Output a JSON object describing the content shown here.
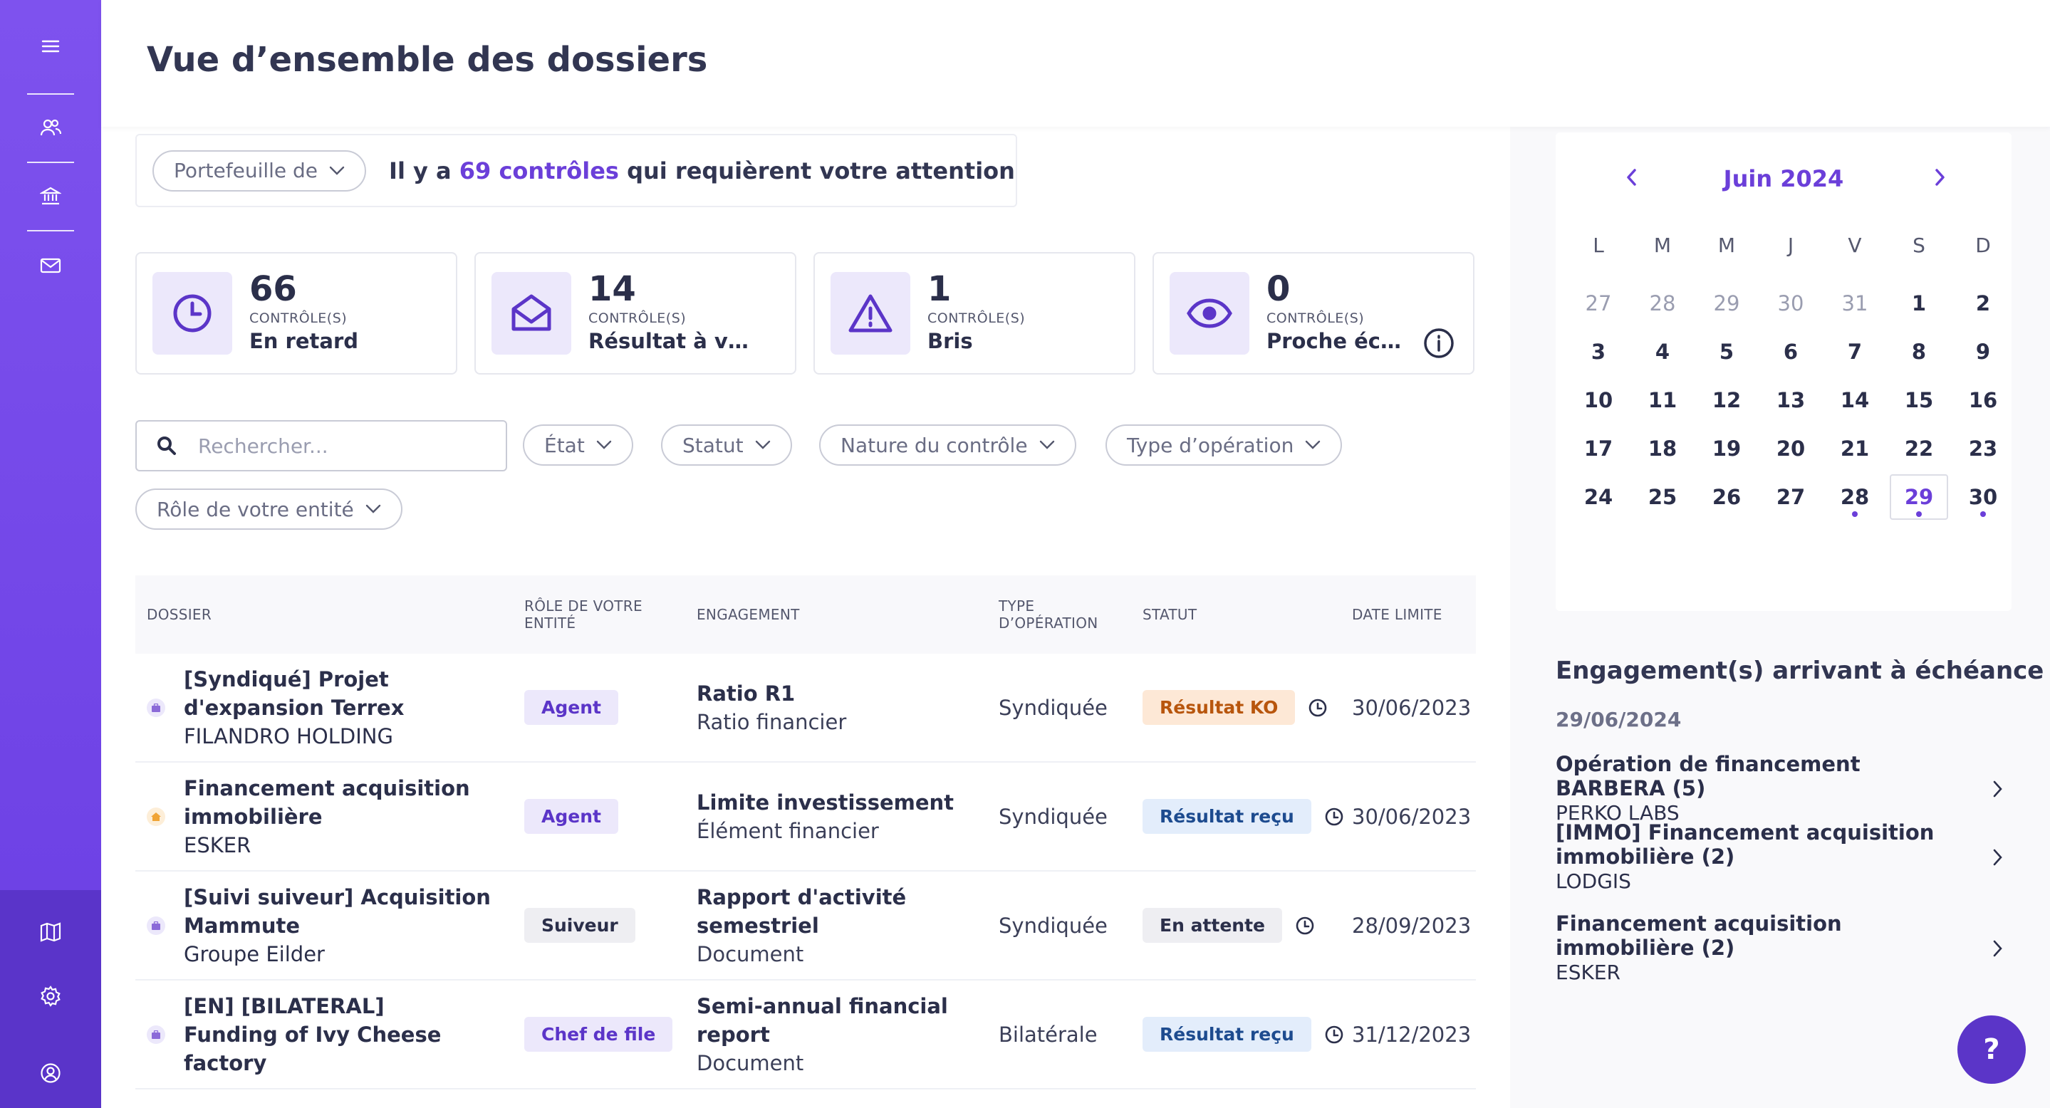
{
  "header": {
    "title": "Vue d’ensemble des dossiers"
  },
  "sidebar": {
    "items": [
      {
        "name": "menu-icon"
      },
      {
        "name": "users-icon"
      },
      {
        "name": "bank-icon"
      },
      {
        "name": "mail-icon"
      },
      {
        "name": "map-icon"
      },
      {
        "name": "settings-icon"
      },
      {
        "name": "account-icon"
      }
    ]
  },
  "attention": {
    "portfolio_label": "Portefeuille de",
    "text_before": "Il y a",
    "count": "69 contrôles",
    "text_after": "qui requièrent votre attention"
  },
  "stats": [
    {
      "number": "66",
      "unit": "CONTRÔLE(S)",
      "label": "En retard",
      "icon": "clock-icon"
    },
    {
      "number": "14",
      "unit": "CONTRÔLE(S)",
      "label": "Résultat à vérifier",
      "icon": "envelope-open-icon"
    },
    {
      "number": "1",
      "unit": "CONTRÔLE(S)",
      "label": "Bris",
      "icon": "warning-icon"
    },
    {
      "number": "0",
      "unit": "CONTRÔLE(S)",
      "label": "Proche échéance",
      "icon": "eye-icon"
    }
  ],
  "search": {
    "placeholder": "Rechercher..."
  },
  "filters": {
    "etat": "État",
    "statut": "Statut",
    "nature": "Nature du contrôle",
    "type_operation": "Type d’opération",
    "role": "Rôle de votre entité"
  },
  "table": {
    "headers": {
      "dossier": "DOSSIER",
      "role": "RÔLE DE VOTRE ENTITÉ",
      "engagement": "ENGAGEMENT",
      "type": "TYPE D’OPÉRATION",
      "statut": "STATUT",
      "date": "DATE LIMITE"
    },
    "rows": [
      {
        "title": "[Syndiqué] Projet d'expansion Terrex",
        "company": "FILANDRO HOLDING",
        "role": "Agent",
        "eng_title": "Ratio R1",
        "eng_sub": "Ratio financier",
        "type": "Syndiquée",
        "status": "Résultat KO",
        "date": "30/06/2023"
      },
      {
        "title": "Financement acquisition immobilière",
        "company": "ESKER",
        "role": "Agent",
        "eng_title": "Limite investissement",
        "eng_sub": "Élément financier",
        "type": "Syndiquée",
        "status": "Résultat reçu",
        "date": "30/06/2023"
      },
      {
        "title": "[Suivi suiveur] Acquisition Mammute",
        "company": "Groupe Eilder",
        "role": "Suiveur",
        "eng_title": "Rapport d'activité semestriel",
        "eng_sub": "Document",
        "type": "Syndiquée",
        "status": "En attente",
        "date": "28/09/2023"
      },
      {
        "title": "[EN] [BILATERAL] Funding of Ivy Cheese factory",
        "company": "",
        "role": "Chef de file",
        "eng_title": "Semi-annual financial report",
        "eng_sub": "Document",
        "type": "Bilatérale",
        "status": "Résultat reçu",
        "date": "31/12/2023"
      }
    ]
  },
  "calendar": {
    "month": "Juin 2024",
    "dow": [
      "L",
      "M",
      "M",
      "J",
      "V",
      "S",
      "D"
    ],
    "weeks": [
      [
        "27",
        "28",
        "29",
        "30",
        "31",
        "1",
        "2"
      ],
      [
        "3",
        "4",
        "5",
        "6",
        "7",
        "8",
        "9"
      ],
      [
        "10",
        "11",
        "12",
        "13",
        "14",
        "15",
        "16"
      ],
      [
        "17",
        "18",
        "19",
        "20",
        "21",
        "22",
        "23"
      ],
      [
        "24",
        "25",
        "26",
        "27",
        "28",
        "29",
        "30"
      ]
    ],
    "selected": "29"
  },
  "deadlines": {
    "title": "Engagement(s) arrivant à échéance",
    "date": "29/06/2024",
    "items": [
      {
        "title": "Opération de financement BARBERA (5)",
        "company": "PERKO LABS"
      },
      {
        "title": "[IMMO] Financement acquisition immobilière (2)",
        "company": "LODGIS"
      },
      {
        "title": "Financement acquisition immobilière (2)",
        "company": "ESKER"
      }
    ]
  },
  "help": {
    "label": "?"
  },
  "colors": {
    "accent": "#6b3fd9",
    "sidebar": "#7446ea",
    "ko": "#fde8d6",
    "recu": "#e3edfb"
  }
}
